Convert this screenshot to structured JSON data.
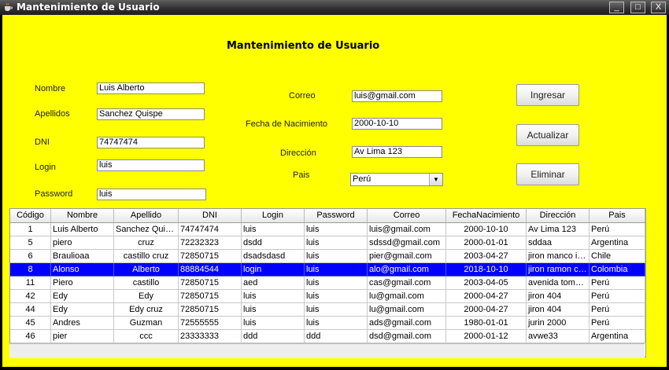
{
  "window": {
    "title": "Mantenimiento de Usuario",
    "controls": [
      "_",
      "□",
      "X"
    ]
  },
  "form": {
    "heading": "Mantenimiento de Usuario",
    "labels": {
      "nombre": "Nombre",
      "apellidos": "Apellidos",
      "dni": "DNI",
      "login": "Login",
      "password": "Password",
      "correo": "Correo",
      "fecha": "Fecha de Nacimiento",
      "direccion": "Dirección",
      "pais": "Pais"
    },
    "values": {
      "nombre": "Luis Alberto",
      "apellidos": "Sanchez Quispe",
      "dni": "74747474",
      "login": "luis",
      "password": "luis",
      "correo": "luis@gmail.com",
      "fecha": "2000-10-10",
      "direccion": "Av Lima 123",
      "pais": "Perú"
    }
  },
  "buttons": {
    "ingresar": "Ingresar",
    "actualizar": "Actualizar",
    "eliminar": "Eliminar"
  },
  "table": {
    "columns": [
      "Código",
      "Nombre",
      "Apellido",
      "DNI",
      "Login",
      "Password",
      "Correo",
      "FechaNacimiento",
      "Dirección",
      "Pais"
    ],
    "selected_index": 3,
    "rows": [
      [
        "1",
        "Luis Alberto",
        "Sanchez Quis...",
        "74747474",
        "luis",
        "luis",
        "luis@gmail.com",
        "2000-10-10",
        "Av Lima 123",
        "Perú"
      ],
      [
        "5",
        "piero",
        "cruz",
        "72232323",
        "dsdd",
        "luis",
        "sdssd@gmail.com",
        "2000-01-01",
        "sddaa",
        "Argentina"
      ],
      [
        "6",
        "Braulioaa",
        "castillo cruz",
        "72850715",
        "dsadsdasd",
        "luis",
        "pier@gmail.com",
        "2003-04-27",
        "jiron manco in...",
        "Chile"
      ],
      [
        "8",
        "Alonso",
        "Alberto",
        "88884544",
        "login",
        "luis",
        "alo@gmail.com",
        "2018-10-10",
        "jiron ramon ca...",
        "Colombia"
      ],
      [
        "11",
        "Piero",
        "castillo",
        "72850715",
        "aed",
        "luis",
        "cas@gmail.com",
        "2003-04-05",
        "avenida tomas ...",
        "Perú"
      ],
      [
        "42",
        "Edy",
        "Edy",
        "72850715",
        "luis",
        "luis",
        "lu@gmail.com",
        "2000-04-27",
        "jiron 404",
        "Perú"
      ],
      [
        "44",
        "Edy",
        "Edy cruz",
        "72850715",
        "luis",
        "luis",
        "lu@gmail.com",
        "2000-04-27",
        "jiron 404",
        "Perú"
      ],
      [
        "45",
        "Andres",
        "Guzman",
        "72555555",
        "luis",
        "luis",
        "ads@gmail.com",
        "1980-01-01",
        "jurin 2000",
        "Perú"
      ],
      [
        "46",
        "pier",
        "ccc",
        "23333333",
        "ddd",
        "ddd",
        "dsd@gmail.com",
        "2000-01-12",
        "avwe33",
        "Argentina"
      ]
    ]
  },
  "colors": {
    "background": "#ffff00",
    "selection": "#0000ff",
    "titlebar": "#2e2e2e"
  }
}
